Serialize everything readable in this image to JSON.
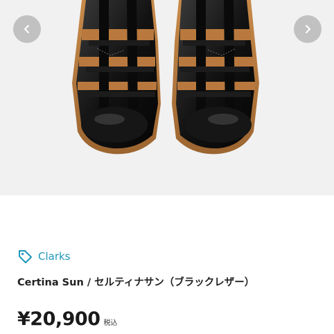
{
  "product": {
    "brand": "Clarks",
    "title": "Certina Sun / セルティナサン（ブラックレザー）",
    "price": "¥20,900",
    "tax_note": "税込"
  },
  "gallery": {
    "prev_icon": "chevron-left-icon",
    "next_icon": "chevron-right-icon",
    "background": "#f1f1f1"
  },
  "colors": {
    "brand_accent": "#1f96b8",
    "nav_button": "#b9b9b9"
  }
}
